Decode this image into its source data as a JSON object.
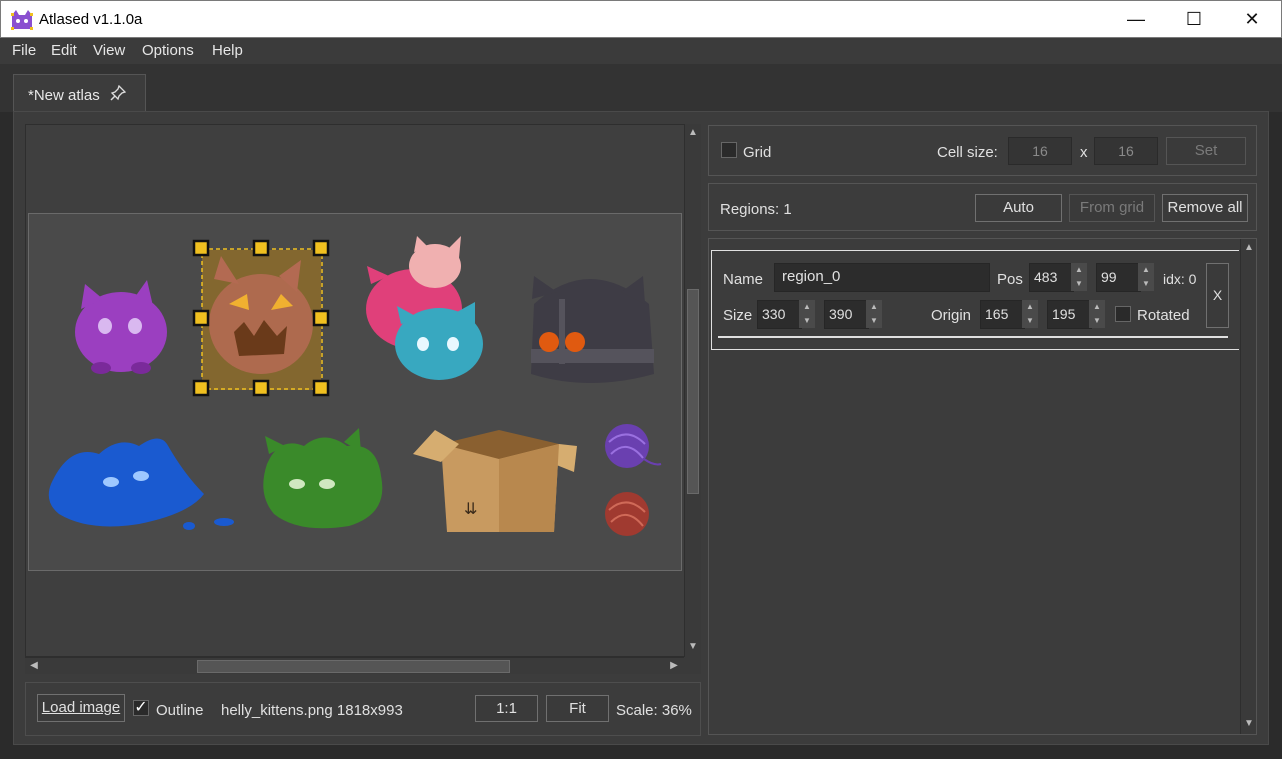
{
  "window": {
    "title": "Atlased v1.1.0a",
    "minimize": "—",
    "maximize": "☐",
    "close": "✕"
  },
  "menu": [
    "File",
    "Edit",
    "View",
    "Options",
    "Help"
  ],
  "tab": {
    "label": "*New atlas"
  },
  "grid": {
    "label": "Grid",
    "cell_size_label": "Cell size:",
    "cell_w": "16",
    "cell_h": "16",
    "x_sep": "x",
    "set_label": "Set"
  },
  "regions": {
    "count_label": "Regions: 1",
    "auto_label": "Auto",
    "from_grid_label": "From grid",
    "remove_all_label": "Remove all"
  },
  "region": {
    "name_label": "Name",
    "name_value": "region_0",
    "pos_label": "Pos",
    "pos_x": "483",
    "pos_y": "99",
    "idx_label": "idx: 0",
    "size_label": "Size",
    "size_w": "330",
    "size_h": "390",
    "origin_label": "Origin",
    "origin_x": "165",
    "origin_y": "195",
    "rotated_label": "Rotated",
    "delete_label": "X"
  },
  "toolbar": {
    "load_image_label": "Load image",
    "outline_label": "Outline",
    "outline_checked": "✓",
    "file_info": "helly_kittens.png 1818x993",
    "one_to_one_label": "1:1",
    "fit_label": "Fit",
    "scale_label": "Scale: 36%"
  },
  "sprites": [
    "purple-cat-slime",
    "pumpkin-slime",
    "pink-cat-pile",
    "dark-cat-helmet",
    "blue-slime",
    "green-slime",
    "cardboard-box",
    "yarn-ball-purple",
    "yarn-ball-red"
  ],
  "colors": {
    "selection": "#f0c020",
    "accent_bg": "#3c3c3c"
  }
}
